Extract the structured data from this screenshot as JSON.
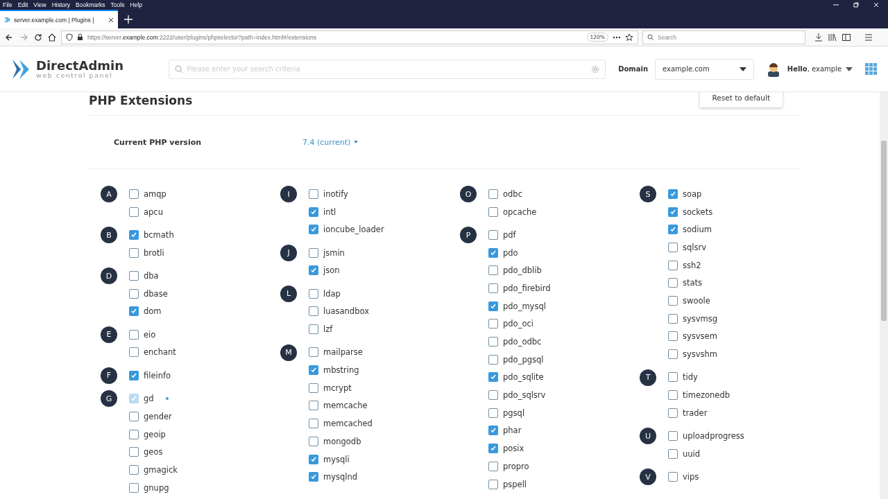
{
  "browser": {
    "menu": [
      "File",
      "Edit",
      "View",
      "History",
      "Bookmarks",
      "Tools",
      "Help"
    ],
    "tab": {
      "title": "server.example.com | Plugins |",
      "selected": true
    },
    "url": "https://server.**example.com**:2222/user/plugins/phpselector?path=index.html#/extensions",
    "zoom": "120%",
    "search": {
      "placeholder": "Search"
    }
  },
  "header": {
    "logo": {
      "name": "DirectAdmin",
      "tagline": "web control panel"
    },
    "search": {
      "placeholder": "Please enter your search criteria"
    },
    "domain_label": "Domain",
    "domain": "example.com",
    "greeting": "**Hello**, example"
  },
  "page": {
    "title": "PHP Extensions",
    "reset_button": "Reset to default",
    "php_version_label": "Current PHP version",
    "php_version": "7.4 (current)"
  },
  "columns": [
    [
      {
        "letter": "A",
        "items": [
          {
            "name": "amqp",
            "checked": false
          },
          {
            "name": "apcu",
            "checked": false
          }
        ]
      },
      {
        "letter": "B",
        "items": [
          {
            "name": "bcmath",
            "checked": true
          },
          {
            "name": "brotli",
            "checked": false
          }
        ]
      },
      {
        "letter": "D",
        "items": [
          {
            "name": "dba",
            "checked": false
          },
          {
            "name": "dbase",
            "checked": false
          },
          {
            "name": "dom",
            "checked": true
          }
        ]
      },
      {
        "letter": "E",
        "items": [
          {
            "name": "eio",
            "checked": false
          },
          {
            "name": "enchant",
            "checked": false
          }
        ]
      },
      {
        "letter": "F",
        "items": [
          {
            "name": "fileinfo",
            "checked": true
          }
        ]
      },
      {
        "letter": "G",
        "items": [
          {
            "name": "gd",
            "checked": true,
            "disabled": true
          },
          {
            "name": "gender",
            "checked": false
          },
          {
            "name": "geoip",
            "checked": false
          },
          {
            "name": "geos",
            "checked": false
          },
          {
            "name": "gmagick",
            "checked": false
          },
          {
            "name": "gnupg",
            "checked": false
          }
        ]
      }
    ],
    [
      {
        "letter": "I",
        "items": [
          {
            "name": "inotify",
            "checked": false
          },
          {
            "name": "intl",
            "checked": true
          },
          {
            "name": "ioncube_loader",
            "checked": true
          }
        ]
      },
      {
        "letter": "J",
        "items": [
          {
            "name": "jsmin",
            "checked": false
          },
          {
            "name": "json",
            "checked": true
          }
        ]
      },
      {
        "letter": "L",
        "items": [
          {
            "name": "ldap",
            "checked": false
          },
          {
            "name": "luasandbox",
            "checked": false
          },
          {
            "name": "lzf",
            "checked": false
          }
        ]
      },
      {
        "letter": "M",
        "items": [
          {
            "name": "mailparse",
            "checked": false
          },
          {
            "name": "mbstring",
            "checked": true
          },
          {
            "name": "mcrypt",
            "checked": false
          },
          {
            "name": "memcache",
            "checked": false
          },
          {
            "name": "memcached",
            "checked": false
          },
          {
            "name": "mongodb",
            "checked": false
          },
          {
            "name": "mysqli",
            "checked": true
          },
          {
            "name": "mysqlnd",
            "checked": true
          }
        ]
      }
    ],
    [
      {
        "letter": "O",
        "items": [
          {
            "name": "odbc",
            "checked": false
          },
          {
            "name": "opcache",
            "checked": false
          }
        ]
      },
      {
        "letter": "P",
        "items": [
          {
            "name": "pdf",
            "checked": false
          },
          {
            "name": "pdo",
            "checked": true
          },
          {
            "name": "pdo_dblib",
            "checked": false
          },
          {
            "name": "pdo_firebird",
            "checked": false
          },
          {
            "name": "pdo_mysql",
            "checked": true
          },
          {
            "name": "pdo_oci",
            "checked": false
          },
          {
            "name": "pdo_odbc",
            "checked": false
          },
          {
            "name": "pdo_pgsql",
            "checked": false
          },
          {
            "name": "pdo_sqlite",
            "checked": true
          },
          {
            "name": "pdo_sqlsrv",
            "checked": false
          },
          {
            "name": "pgsql",
            "checked": false
          },
          {
            "name": "phar",
            "checked": true
          },
          {
            "name": "posix",
            "checked": true
          },
          {
            "name": "propro",
            "checked": false
          },
          {
            "name": "pspell",
            "checked": false
          }
        ]
      }
    ],
    [
      {
        "letter": "S",
        "items": [
          {
            "name": "soap",
            "checked": true
          },
          {
            "name": "sockets",
            "checked": true
          },
          {
            "name": "sodium",
            "checked": true
          },
          {
            "name": "sqlsrv",
            "checked": false
          },
          {
            "name": "ssh2",
            "checked": false
          },
          {
            "name": "stats",
            "checked": false
          },
          {
            "name": "swoole",
            "checked": false
          },
          {
            "name": "sysvmsg",
            "checked": false
          },
          {
            "name": "sysvsem",
            "checked": false
          },
          {
            "name": "sysvshm",
            "checked": false
          }
        ]
      },
      {
        "letter": "T",
        "items": [
          {
            "name": "tidy",
            "checked": false
          },
          {
            "name": "timezonedb",
            "checked": false
          },
          {
            "name": "trader",
            "checked": false
          }
        ]
      },
      {
        "letter": "U",
        "items": [
          {
            "name": "uploadprogress",
            "checked": false
          },
          {
            "name": "uuid",
            "checked": false
          }
        ]
      },
      {
        "letter": "V",
        "items": [
          {
            "name": "vips",
            "checked": false
          }
        ]
      }
    ]
  ]
}
